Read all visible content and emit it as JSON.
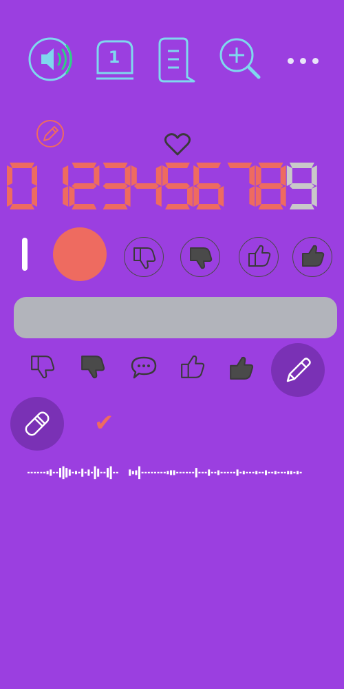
{
  "toolbar": {
    "icons": [
      "speaker-icon",
      "tab-number-icon",
      "document-icon",
      "zoom-in-icon",
      "more-icon"
    ],
    "tab_count": "1"
  },
  "display": {
    "digits": "0123456789",
    "segment_color": "#ee6b60",
    "dim_digit_color": "#c9c9c9"
  },
  "colors": {
    "background": "#9b3fe0",
    "accent_cyan": "#7fd8ee",
    "accent_green": "#2fcf86",
    "record": "#ee6b60",
    "fab": "#7a31b5",
    "text_bar": "#b2b4bb"
  },
  "reactions_row": [
    "thumbs-down-outline-icon",
    "thumbs-down-filled-icon",
    "chat-icon",
    "thumbs-up-outline-icon",
    "thumbs-up-filled-icon"
  ],
  "check_mark": "✔"
}
